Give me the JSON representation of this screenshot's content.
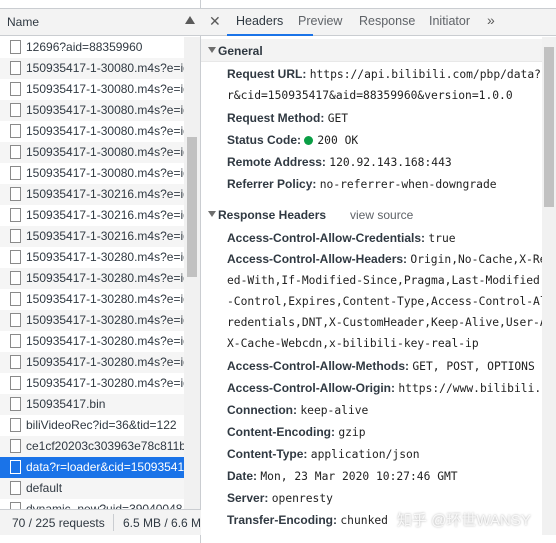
{
  "request_list": {
    "header": {
      "name_label": "Name"
    },
    "rows": [
      {
        "name": "12696?aid=88359960",
        "selected": false
      },
      {
        "name": "150935417-1-30080.m4s?e=ig",
        "selected": false
      },
      {
        "name": "150935417-1-30080.m4s?e=ig",
        "selected": false
      },
      {
        "name": "150935417-1-30080.m4s?e=ig",
        "selected": false
      },
      {
        "name": "150935417-1-30080.m4s?e=ig",
        "selected": false
      },
      {
        "name": "150935417-1-30080.m4s?e=ig",
        "selected": false
      },
      {
        "name": "150935417-1-30080.m4s?e=ig",
        "selected": false
      },
      {
        "name": "150935417-1-30216.m4s?e=ig",
        "selected": false
      },
      {
        "name": "150935417-1-30216.m4s?e=ig",
        "selected": false
      },
      {
        "name": "150935417-1-30216.m4s?e=ig",
        "selected": false
      },
      {
        "name": "150935417-1-30280.m4s?e=ig",
        "selected": false
      },
      {
        "name": "150935417-1-30280.m4s?e=ig",
        "selected": false
      },
      {
        "name": "150935417-1-30280.m4s?e=ig",
        "selected": false
      },
      {
        "name": "150935417-1-30280.m4s?e=ig",
        "selected": false
      },
      {
        "name": "150935417-1-30280.m4s?e=ig",
        "selected": false
      },
      {
        "name": "150935417-1-30280.m4s?e=ig",
        "selected": false
      },
      {
        "name": "150935417-1-30280.m4s?e=ig",
        "selected": false
      },
      {
        "name": "150935417.bin",
        "selected": false
      },
      {
        "name": "biliVideoRec?id=36&tid=122",
        "selected": false
      },
      {
        "name": "ce1cf20203c303963e78c811b",
        "selected": false
      },
      {
        "name": "data?r=loader&cid=15093541",
        "selected": true
      },
      {
        "name": "default",
        "selected": false
      },
      {
        "name": "dynamic_new?uid=39040048",
        "selected": false
      }
    ],
    "status": {
      "requests": "70 / 225 requests",
      "size": "6.5 MB / 6.6 M"
    }
  },
  "tabs": {
    "items": [
      "Headers",
      "Preview",
      "Response",
      "Initiator"
    ],
    "active": "Headers",
    "close_symbol": "✕",
    "more_symbol": "»"
  },
  "general": {
    "title": "General",
    "request_url_label": "Request URL:",
    "request_url_1": "https://api.bilibili.com/pbp/data?r",
    "request_url_2": "r&cid=150935417&aid=88359960&version=1.0.0",
    "request_method_label": "Request Method:",
    "request_method": "GET",
    "status_code_label": "Status Code:",
    "status_code": "200 OK",
    "status_color": "#0a9e45",
    "remote_address_label": "Remote Address:",
    "remote_address": "120.92.143.168:443",
    "referrer_policy_label": "Referrer Policy:",
    "referrer_policy": "no-referrer-when-downgrade"
  },
  "response_headers": {
    "title": "Response Headers",
    "view_source": "view source",
    "acac_label": "Access-Control-Allow-Credentials:",
    "acac": "true",
    "acah_label": "Access-Control-Allow-Headers:",
    "acah_1": "Origin,No-Cache,X-Re",
    "acah_2": "ed-With,If-Modified-Since,Pragma,Last-Modified,C",
    "acah_3": "-Control,Expires,Content-Type,Access-Control-All",
    "acah_4": "redentials,DNT,X-CustomHeader,Keep-Alive,User-Ag",
    "acah_5": "X-Cache-Webcdn,x-bilibili-key-real-ip",
    "acam_label": "Access-Control-Allow-Methods:",
    "acam": "GET, POST, OPTIONS",
    "acao_label": "Access-Control-Allow-Origin:",
    "acao": "https://www.bilibili.c",
    "connection_label": "Connection:",
    "connection": "keep-alive",
    "content_encoding_label": "Content-Encoding:",
    "content_encoding": "gzip",
    "content_type_label": "Content-Type:",
    "content_type": "application/json",
    "date_label": "Date:",
    "date": "Mon, 23 Mar 2020 10:27:46 GMT",
    "server_label": "Server:",
    "server": "openresty",
    "transfer_encoding_label": "Transfer-Encoding:",
    "transfer_encoding": "chunked"
  },
  "watermark": "知乎 @环世WANSY",
  "colors": {
    "selected_row": "#1a73e8",
    "active_tab_underline": "#1a73e8",
    "panel_bg": "#f3f3f3"
  }
}
